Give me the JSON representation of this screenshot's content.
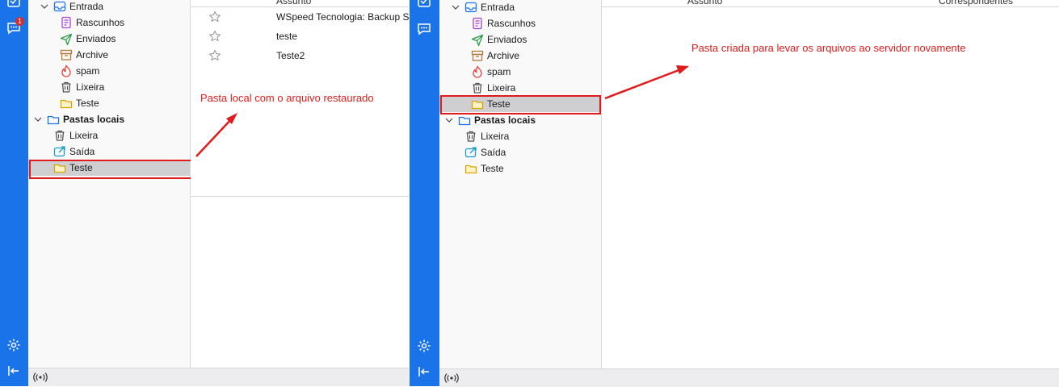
{
  "left": {
    "badge_count": "1",
    "folders": [
      {
        "label": "Entrada",
        "icon": "inbox-icon"
      },
      {
        "label": "Rascunhos",
        "icon": "drafts-icon"
      },
      {
        "label": "Enviados",
        "icon": "sent-icon"
      },
      {
        "label": "Archive",
        "icon": "archive-icon"
      },
      {
        "label": "spam",
        "icon": "spam-icon"
      },
      {
        "label": "Lixeira",
        "icon": "trash-icon"
      },
      {
        "label": "Teste",
        "icon": "folder-icon"
      }
    ],
    "local_account": "Pastas locais",
    "local_folders": [
      {
        "label": "Lixeira",
        "icon": "trash-icon"
      },
      {
        "label": "Saída",
        "icon": "outbox-icon"
      },
      {
        "label": "Teste",
        "icon": "folder-icon",
        "selected": true
      }
    ],
    "header_subject": "Assunto",
    "messages": [
      {
        "subject": "WSpeed Tecnologia: Backup SU"
      },
      {
        "subject": "teste"
      },
      {
        "subject": "Teste2"
      }
    ],
    "annotation": "Pasta local com o arquivo restaurado"
  },
  "right": {
    "folders": [
      {
        "label": "Entrada",
        "icon": "inbox-icon"
      },
      {
        "label": "Rascunhos",
        "icon": "drafts-icon"
      },
      {
        "label": "Enviados",
        "icon": "sent-icon"
      },
      {
        "label": "Archive",
        "icon": "archive-icon"
      },
      {
        "label": "spam",
        "icon": "spam-icon"
      },
      {
        "label": "Lixeira",
        "icon": "trash-icon"
      },
      {
        "label": "Teste",
        "icon": "folder-icon",
        "selected": true
      }
    ],
    "local_account": "Pastas locais",
    "local_folders": [
      {
        "label": "Lixeira",
        "icon": "trash-icon"
      },
      {
        "label": "Saída",
        "icon": "outbox-icon"
      },
      {
        "label": "Teste",
        "icon": "folder-icon"
      }
    ],
    "header_subject": "Assunto",
    "header_correspondents": "Correspondentes",
    "annotation": "Pasta criada para levar os arquivos ao servidor novamente"
  },
  "colors": {
    "spaces_bar": "#1a73e8",
    "annotation": "#e01b1b",
    "selection": "#cfcfd2"
  }
}
